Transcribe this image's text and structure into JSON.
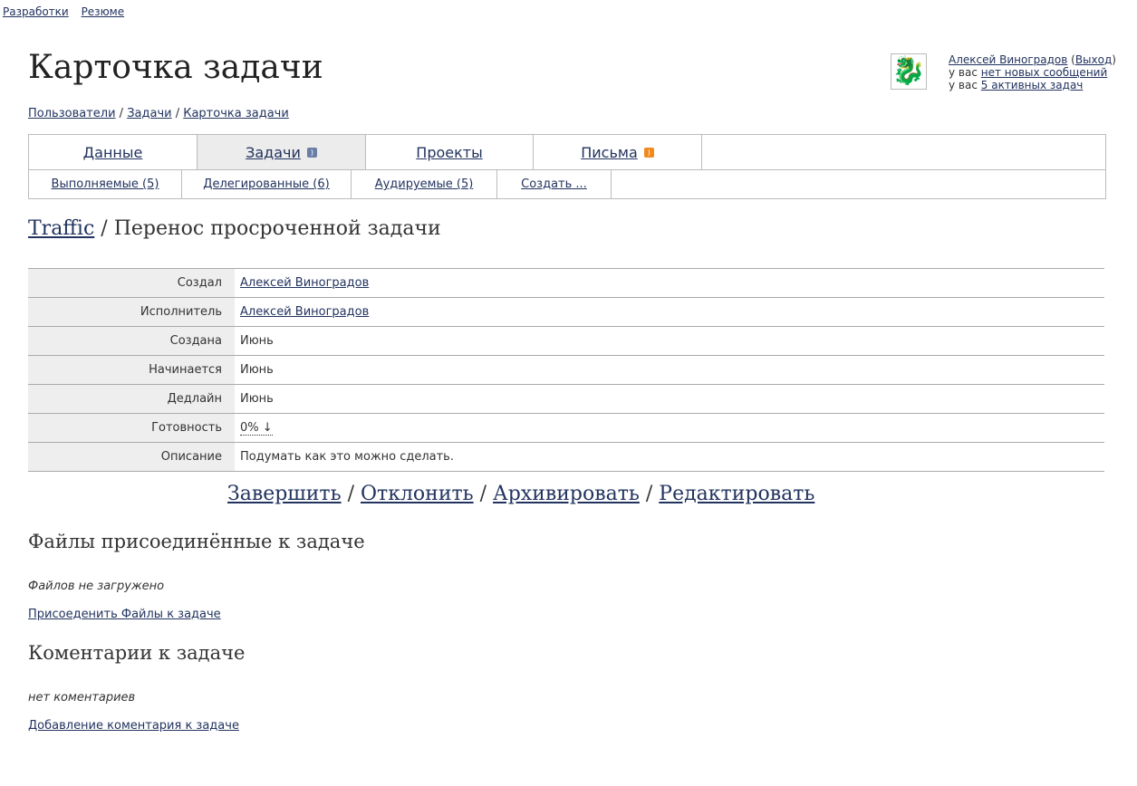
{
  "top_nav": [
    "Разработки",
    "Резюме"
  ],
  "page_title": "Карточка задачи",
  "user": {
    "name": "Алексей Виноградов",
    "logout_open": "(",
    "logout": "Выход",
    "logout_close": ")",
    "messages_prefix": "у вас ",
    "messages_link": "нет новых сообщений",
    "tasks_prefix": "у вас ",
    "tasks_link": "5 активных задач"
  },
  "breadcrumb": {
    "items": [
      "Пользователи",
      "Задачи",
      "Карточка задачи"
    ],
    "separator": " / "
  },
  "tabs": [
    {
      "label": "Данные"
    },
    {
      "label": "Задачи",
      "feed_icon": "rss-feed-icon"
    },
    {
      "label": "Проекты"
    },
    {
      "label": "Письма",
      "feed_icon": "rss-feed-icon"
    }
  ],
  "subtabs": [
    "Выполняемые (5)",
    "Делегированные (6)",
    "Аудируемые (5)",
    "Создать ..."
  ],
  "task": {
    "project": "Traffic",
    "separator": " / ",
    "title": "Перенос просроченной задачи"
  },
  "details": [
    {
      "label": "Создал",
      "value": "Алексей Виноградов"
    },
    {
      "label": "Исполнитель",
      "value": "Алексей Виноградов"
    },
    {
      "label": "Создана",
      "value": "Июнь"
    },
    {
      "label": "Начинается",
      "value": "Июнь"
    },
    {
      "label": "Дедлайн",
      "value": "Июнь"
    },
    {
      "label": "Готовность",
      "value": "0% ↓"
    },
    {
      "label": "Описание",
      "value": "Подумать как это можно сделать."
    }
  ],
  "actions": {
    "items": [
      "Завершить",
      "Отклонить",
      "Архивировать",
      "Редактировать"
    ],
    "separator": " / "
  },
  "files": {
    "title": "Файлы присоединённые к задаче",
    "empty": "Файлов не загружено",
    "link": "Присоеденить Файлы к задаче"
  },
  "comments": {
    "title": "Коментарии к задаче",
    "empty": "нет коментариев",
    "link": "Добавление коментария к задаче"
  },
  "colors": {
    "link": "#22335f",
    "label_bg": "#eeeeee",
    "active_tab_bg": "#ececec",
    "border": "#bcbcbc",
    "rss_orange": "#f08a1c"
  }
}
